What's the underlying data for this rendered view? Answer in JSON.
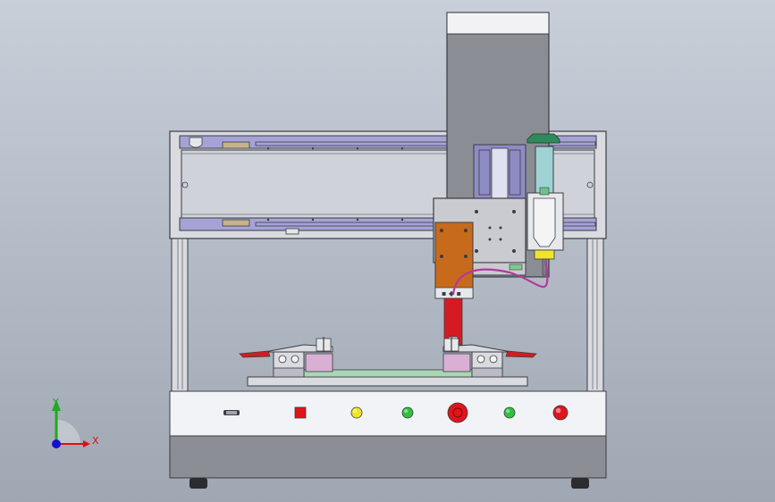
{
  "triad": {
    "x_label": "X",
    "y_label": "Y"
  },
  "colors": {
    "bg_top": "#c8cfd9",
    "bg_bottom": "#9fa7b3",
    "frame_fill": "#d9dbe0",
    "frame_stroke": "#3a3d42",
    "gantry_fill": "#b9bcc4",
    "gantry_inner": "#cfd2d8",
    "lavender": "#a5a3d6",
    "lavender_dark": "#8f8cc4",
    "column_fill": "#8a8d93",
    "column_top": "#f2f2f4",
    "plate_fill": "#c9cbd0",
    "bracket_orange": "#c76a1c",
    "rod_red": "#d61a22",
    "syringe_teal": "#9ed2d3",
    "syringe_green": "#2f8a5b",
    "cable_magenta": "#b3399b",
    "pink_block": "#d9b0d4",
    "pcb_green": "#a9d6b4",
    "panel_white": "#f2f3f7",
    "base_fill": "#8b8e94",
    "foot_dark": "#2b2c2e",
    "btn_red": "#e0141b",
    "btn_yellow": "#f0e32a",
    "btn_green": "#2fbf3d",
    "triad_red": "#e01010",
    "triad_green": "#1faa1f",
    "triad_blue": "#1010d0"
  },
  "panel_controls": [
    {
      "name": "display-window-icon",
      "type": "display",
      "color": "#3a3d42"
    },
    {
      "name": "stop-button",
      "type": "square",
      "color": "#e0141b"
    },
    {
      "name": "yellow-indicator-button",
      "type": "round",
      "color": "#f0e32a"
    },
    {
      "name": "green-indicator-button",
      "type": "round",
      "color": "#2fbf3d"
    },
    {
      "name": "emergency-stop-button",
      "type": "mushroom",
      "color": "#e0141b"
    },
    {
      "name": "start-button",
      "type": "round",
      "color": "#2fbf3d"
    },
    {
      "name": "reset-button",
      "type": "round-large",
      "color": "#e0141b"
    }
  ]
}
